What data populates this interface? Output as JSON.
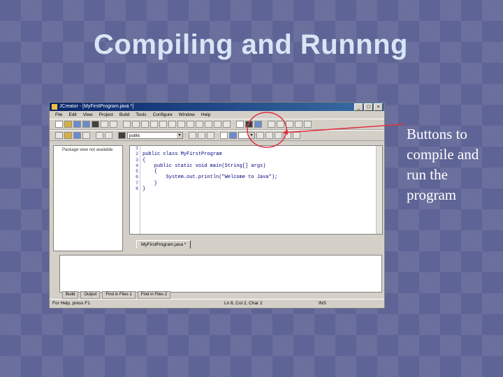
{
  "slide": {
    "title": "Compiling and Runnng",
    "callout": "Buttons to compile and run the program"
  },
  "window": {
    "title": "JCreator - [MyFirstProgram.java *]",
    "controls": [
      "_",
      "□",
      "×"
    ]
  },
  "menu": [
    "File",
    "Edit",
    "View",
    "Project",
    "Build",
    "Tools",
    "Configure",
    "Window",
    "Help"
  ],
  "toolbar": {
    "combo_value": "public"
  },
  "left_pane": {
    "label": "Package view not available"
  },
  "editor": {
    "line_numbers": [
      "1",
      "2",
      "3",
      "4",
      "5",
      "6",
      "7",
      "8"
    ],
    "code_lines": [
      "",
      "public class MyFirstProgram",
      "{",
      "    public static void main(String[] args)",
      "    {",
      "        System.out.println(\"Welcome to Java\");",
      "    }",
      "}"
    ]
  },
  "doc_tab": "MyFirstProgram.java *",
  "output_tabs": [
    "Build",
    "Output",
    "Find in Files 1",
    "Find in Files 2"
  ],
  "status": {
    "left": "For Help, press F1",
    "mid": "Ln 8, Col 2, Char 2",
    "right": "INS"
  },
  "annotation_color": "#e03040"
}
